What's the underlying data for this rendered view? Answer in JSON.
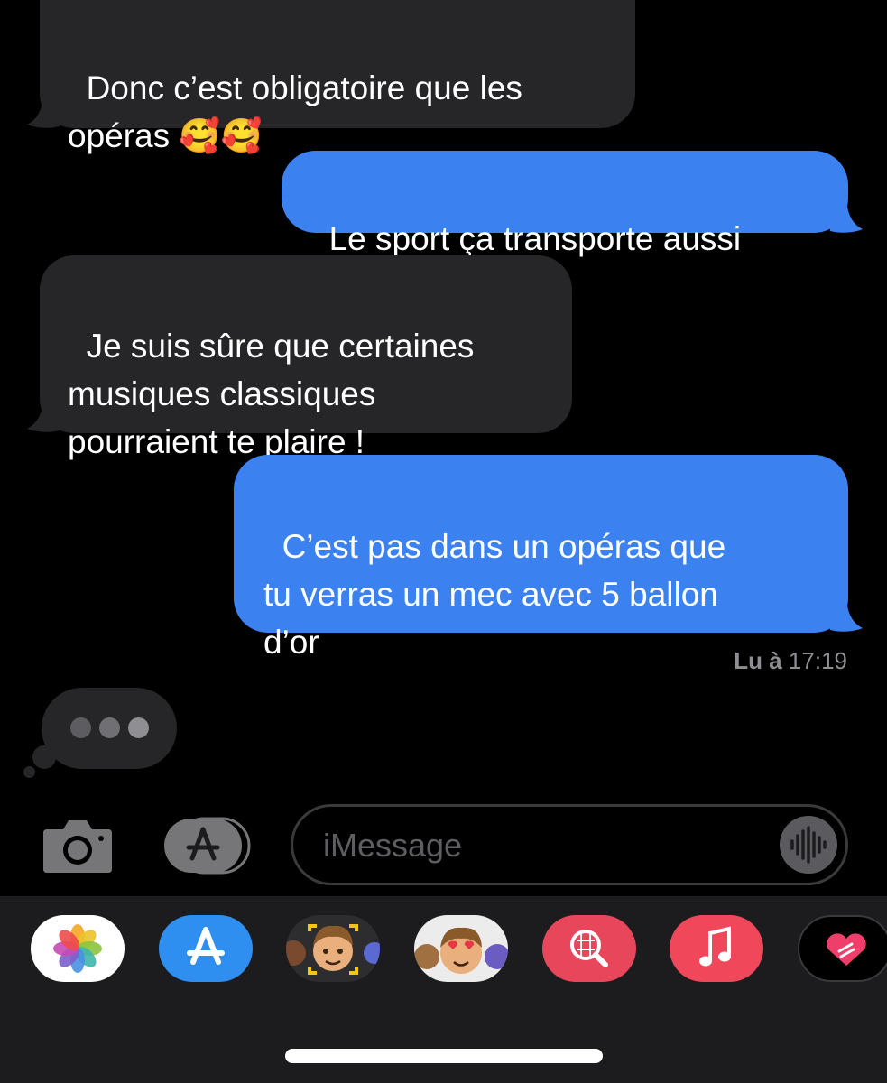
{
  "messages": [
    {
      "from": "them",
      "text": "Donc c’est obligatoire que les\nopéras 🥰🥰"
    },
    {
      "from": "me",
      "text": "Le sport ça transporte aussi"
    },
    {
      "from": "them",
      "text": "Je suis sûre que certaines\nmusiques classiques\npourraient te plaire !"
    },
    {
      "from": "me",
      "text": "C’est pas dans un opéras que\ntu verras un mec avec 5 ballon\nd’or"
    }
  ],
  "read_receipt": {
    "label": "Lu à",
    "time": "17:19"
  },
  "composer": {
    "placeholder": "iMessage"
  },
  "app_drawer": [
    "photos-app",
    "app-store-app",
    "memoji-app",
    "memoji-stickers-app",
    "web-images-search-app",
    "music-app",
    "digital-touch-app"
  ],
  "colors": {
    "outgoing": "#3b82f0",
    "incoming": "#262629",
    "background": "#000000"
  }
}
